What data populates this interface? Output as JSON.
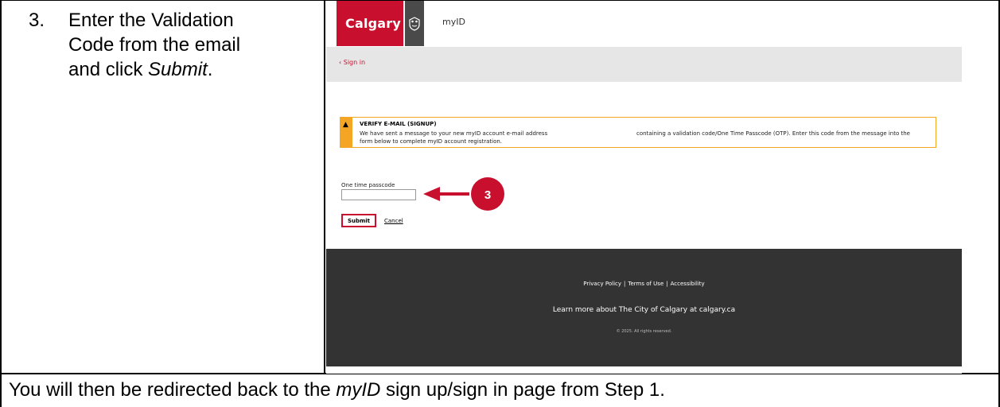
{
  "step": {
    "number": "3.",
    "line1": "Enter the Validation",
    "line2": "Code from the email",
    "line3_prefix": "and click ",
    "line3_emph": "Submit",
    "line3_suffix": "."
  },
  "bottom_note": {
    "prefix": "You will then be redirected back to the ",
    "emph": "myID",
    "suffix": " sign up/sign in page from Step 1."
  },
  "screenshot": {
    "header": {
      "logo_text": "Calgary",
      "crest_icon": "city-crest-icon",
      "app_name": "myID"
    },
    "back_link": "‹ Sign in",
    "notice": {
      "icon": "warning-icon",
      "title": "VERIFY E-MAIL (SIGNUP)",
      "body_part1": "We have sent a message to your new myID account e-mail address",
      "body_part2": "containing a validation code/One Time Passcode (OTP). Enter this code from the message into the",
      "body_line2": "form below to complete myID account registration."
    },
    "form": {
      "otp_label": "One time passcode",
      "otp_value": "",
      "submit_label": "Submit",
      "cancel_label": "Cancel"
    },
    "callout": {
      "number": "3",
      "color": "#c8102e"
    },
    "footer": {
      "links": [
        "Privacy Policy",
        "Terms of Use",
        "Accessibility"
      ],
      "separator": "|",
      "learn_more": "Learn more about The City of Calgary at calgary.ca",
      "copyright": "© 2025. All rights reserved."
    }
  },
  "colors": {
    "brand_red": "#c8102e",
    "warning_orange": "#f4a523",
    "footer_bg": "#333333"
  }
}
